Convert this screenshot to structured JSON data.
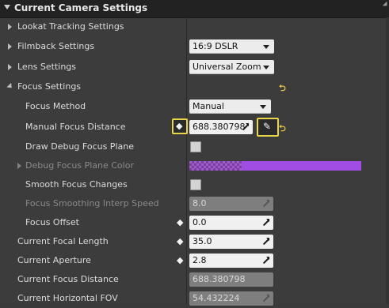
{
  "header": {
    "title": "Current Camera Settings"
  },
  "rows": {
    "lookat": {
      "label": "Lookat Tracking Settings"
    },
    "filmback": {
      "label": "Filmback Settings",
      "value": "16:9 DSLR"
    },
    "lens": {
      "label": "Lens Settings",
      "value": "Universal Zoom"
    },
    "focus_settings": {
      "label": "Focus Settings"
    },
    "focus_method": {
      "label": "Focus Method",
      "value": "Manual"
    },
    "manual_focus_distance": {
      "label": "Manual Focus Distance",
      "value": "688.380798"
    },
    "draw_debug_focus_plane": {
      "label": "Draw Debug Focus Plane"
    },
    "debug_focus_plane_color": {
      "label": "Debug Focus Plane Color",
      "color": "#a14ce3"
    },
    "smooth_focus_changes": {
      "label": "Smooth Focus Changes"
    },
    "focus_smoothing_interp_speed": {
      "label": "Focus Smoothing Interp Speed",
      "value": "8.0"
    },
    "focus_offset": {
      "label": "Focus Offset",
      "value": "0.0"
    },
    "current_focal_length": {
      "label": "Current Focal Length",
      "value": "35.0"
    },
    "current_aperture": {
      "label": "Current Aperture",
      "value": "2.8"
    },
    "current_focus_distance": {
      "label": "Current Focus Distance",
      "value": "688.380798"
    },
    "current_horizontal_fov": {
      "label": "Current Horizontal FOV",
      "value": "54.432224"
    }
  },
  "icons": {
    "bind": "keyframe-diamond-icon",
    "reset": "reset-to-default-icon",
    "picker": "eyedropper-icon",
    "highlight_color": "#e7d54a",
    "reset_color": "#e7c744"
  }
}
